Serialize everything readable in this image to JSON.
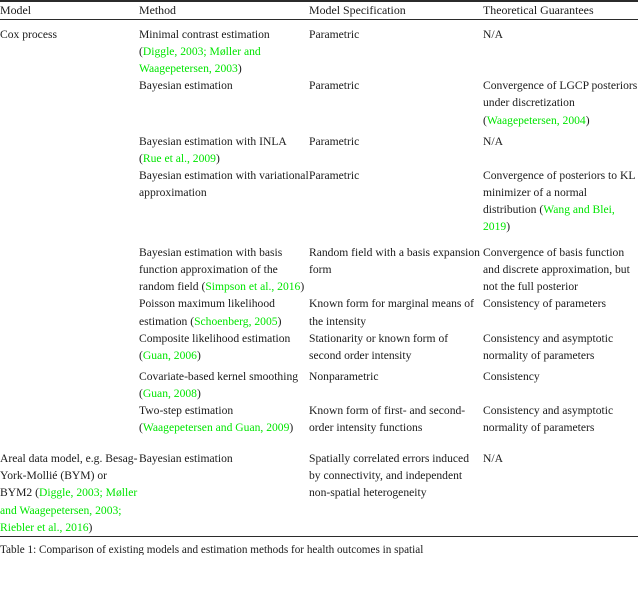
{
  "document": {
    "type": "academic-paper-table",
    "citation_color": "#00e500",
    "text_color": "#1a1a1a",
    "rule_color": "#2b2b2b"
  },
  "table": {
    "headers": [
      "Model",
      "Method",
      "Model Specification",
      "Theoretical Guarantees"
    ],
    "rows": [
      {
        "model": "Cox process",
        "entries": [
          {
            "method": "Minimal contrast estimation (Diggle, 2003; Møller and Waagepetersen, 2003)",
            "method_plain": "Minimal contrast estimation (",
            "method_cite": "Diggle, 2003; Møller and Waagepetersen, 2003",
            "specification": "Parametric",
            "guarantees": "N/A",
            "guarantees_cite": ""
          },
          {
            "method": "Bayesian estimation",
            "method_plain": "Bayesian estimation",
            "method_cite": "",
            "specification": "Parametric",
            "guarantees": "Convergence of LGCP posteriors under discretization (Waagepetersen, 2004)",
            "guarantees_plain": "Convergence of LGCP posteriors under discretization (",
            "guarantees_cite": "Waagepetersen, 2004"
          },
          {
            "method": "Bayesian estimation with INLA (Rue et al., 2009)",
            "method_plain": "Bayesian estimation with INLA (",
            "method_cite": "Rue et al., 2009",
            "specification": "Parametric",
            "guarantees": "N/A",
            "guarantees_cite": ""
          },
          {
            "method": "Bayesian estimation with variational approximation",
            "method_plain": "Bayesian estimation with variational approximation",
            "method_cite": "",
            "specification": "Parametric",
            "guarantees": "Convergence of posteriors to KL minimizer of a normal distribution (Wang and Blei, 2019)",
            "guarantees_plain": "Convergence of posteriors to KL minimizer of a normal distribution (",
            "guarantees_cite": "Wang and Blei, 2019"
          },
          {
            "method": "Bayesian estimation with basis function approximation of the random field (Simpson et al., 2016)",
            "method_plain": "Bayesian estimation with basis function approximation of the random field (",
            "method_cite": "Simpson et al., 2016",
            "specification": "Random field with a basis expansion form",
            "guarantees": "Convergence of basis function and discrete approximation, but not the full posterior",
            "guarantees_cite": ""
          },
          {
            "method": "Poisson maximum likelihood estimation (Schoenberg, 2005)",
            "method_plain": "Poisson maximum likelihood estimation (",
            "method_cite": "Schoenberg, 2005",
            "specification": "Known form for marginal means of the intensity",
            "guarantees": "Consistency of parameters",
            "guarantees_cite": ""
          },
          {
            "method": "Composite likelihood estimation (Guan, 2006)",
            "method_plain": "Composite likelihood estimation (",
            "method_cite": "Guan, 2006",
            "specification": "Stationarity or known form of second order intensity",
            "guarantees": "Consistency and asymptotic normality of parameters",
            "guarantees_cite": ""
          },
          {
            "method": "Covariate-based kernel smoothing (Guan, 2008)",
            "method_plain": "Covariate-based kernel smoothing (",
            "method_cite": "Guan, 2008",
            "specification": "Nonparametric",
            "guarantees": "Consistency",
            "guarantees_cite": ""
          },
          {
            "method": "Two-step estimation (Waagepetersen and Guan, 2009)",
            "method_plain": "Two-step estimation (",
            "method_cite": "Waagepetersen and Guan, 2009",
            "specification": "Known form of first- and second-order intensity functions",
            "guarantees": "Consistency and asymptotic normality of parameters",
            "guarantees_cite": ""
          }
        ]
      },
      {
        "model": "Areal data model, e.g. Besag-York-Mollié (BYM) or BYM2 (Diggle, 2003; Møller and Waagepetersen, 2003; Riebler et al., 2016)",
        "model_plain": "Areal data model, e.g. Besag-York-Mollié (BYM) or BYM2 (",
        "model_cite": "Diggle, 2003; Møller and Waagepetersen, 2003; Riebler et al., 2016",
        "entries": [
          {
            "method": "Bayesian estimation",
            "method_plain": "Bayesian estimation",
            "method_cite": "",
            "specification": "Spatially correlated errors induced by connectivity, and independent non-spatial heterogeneity",
            "guarantees": "N/A",
            "guarantees_cite": ""
          }
        ]
      }
    ]
  },
  "caption": {
    "text": "Table 1: Comparison of existing models and estimation methods for health outcomes in spatial"
  }
}
